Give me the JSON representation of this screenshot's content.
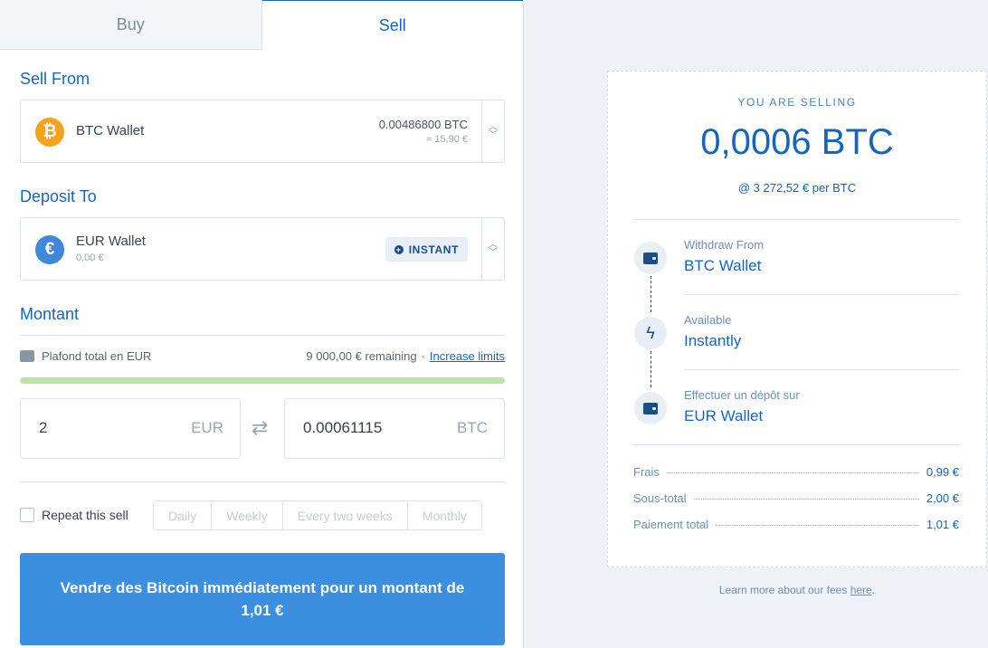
{
  "tabs": [
    {
      "label": "Buy"
    },
    {
      "label": "Sell"
    }
  ],
  "sell_from": {
    "title": "Sell From",
    "wallet_name": "BTC Wallet",
    "balance": "0.00486800 BTC",
    "balance_fiat": "≈ 15,90 €",
    "coin_glyph": "₿",
    "coin_color": "#f7a21b"
  },
  "deposit_to": {
    "title": "Deposit To",
    "wallet_name": "EUR Wallet",
    "balance": "0,00 €",
    "badge": "INSTANT",
    "coin_glyph": "€",
    "coin_color": "#3f88d8"
  },
  "amount": {
    "title": "Montant",
    "limit_label": "Plafond total en EUR",
    "remaining": "9 000,00 € remaining",
    "separator": "·",
    "increase_link": "Increase limits",
    "progress": 1.0,
    "fiat_value": "2",
    "fiat_currency": "EUR",
    "crypto_value": "0.00061115",
    "crypto_currency": "BTC"
  },
  "repeat": {
    "label": "Repeat this sell",
    "options": [
      "Daily",
      "Weekly",
      "Every two weeks",
      "Monthly"
    ]
  },
  "cta_label": "Vendre des Bitcoin immédiatement pour un montant de 1,01 €",
  "summary": {
    "label": "YOU ARE SELLING",
    "amount": "0,0006 BTC",
    "rate": "@ 3 272,52 € per BTC",
    "steps": [
      {
        "label": "Withdraw From",
        "value": "BTC Wallet"
      },
      {
        "label": "Available",
        "value": "Instantly"
      },
      {
        "label": "Effectuer un dépôt sur",
        "value": "EUR Wallet"
      }
    ],
    "fees": [
      {
        "label": "Frais",
        "value": "0,99 €"
      },
      {
        "label": "Sous-total",
        "value": "2,00 €"
      },
      {
        "label": "Paiement total",
        "value": "1,01 €"
      }
    ]
  },
  "footer": {
    "text": "Learn more about our fees ",
    "link": "here",
    "end": "."
  }
}
